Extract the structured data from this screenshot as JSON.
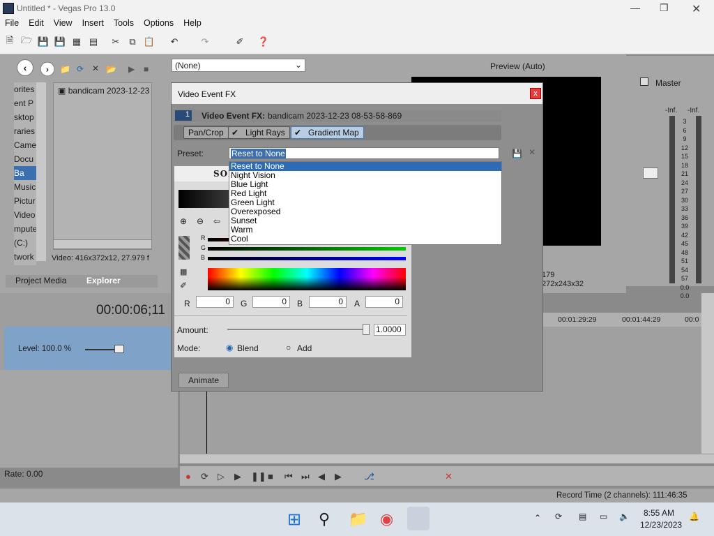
{
  "window": {
    "title": "Untitled * - Vegas Pro 13.0"
  },
  "menu": [
    "File",
    "Edit",
    "View",
    "Insert",
    "Tools",
    "Options",
    "Help"
  ],
  "explorer": {
    "tree": [
      "orites",
      "ent P",
      "sktop",
      "raries",
      "Came",
      "Docu",
      "Ba",
      "Music",
      "Pictur",
      "Video",
      "mpute",
      "(C:)",
      "twork"
    ],
    "file": "bandicam 2023-12-23",
    "info": "Video: 416x372x12, 27.979 f",
    "tabs": [
      "Project Media",
      "Explorer"
    ]
  },
  "preview": {
    "mode": "(None)",
    "quality": "Preview (Auto)",
    "info1": "179",
    "info2": "272x243x32"
  },
  "timeline": {
    "time": "00:00:06;11",
    "level": "Level: 100.0 %",
    "rate": "Rate: 0.00",
    "ruler": [
      "00:01:29:29",
      "00:01:44:29",
      "00:0"
    ]
  },
  "mixer": {
    "title": "Master",
    "inf_left": "-Inf.",
    "inf_right": "-Inf.",
    "scale": [
      "3",
      "6",
      "9",
      "12",
      "15",
      "18",
      "21",
      "24",
      "27",
      "30",
      "33",
      "36",
      "39",
      "42",
      "45",
      "48",
      "51",
      "54",
      "57",
      "0.0",
      "0.0"
    ]
  },
  "dialog": {
    "title": "Video Event FX",
    "close": "x",
    "track_num": "1",
    "fx_label": "Video Event FX:",
    "fx_event": "bandicam 2023-12-23 08-53-58-869",
    "chain": [
      "Pan/Crop",
      "Light Rays",
      "Gradient Map"
    ],
    "preset_label": "Preset:",
    "preset_value": "Reset to None",
    "preset_options": [
      "Reset to None",
      "Night Vision",
      "Blue Light",
      "Red  Light",
      "Green  Light",
      "Overexposed",
      "Sunset",
      "Warm",
      "Cool"
    ],
    "sony": "SON",
    "rgb_labels": [
      "R",
      "G",
      "B"
    ],
    "r_label": "R",
    "r_val": "0",
    "g_label": "G",
    "g_val": "0",
    "b_label": "B",
    "b_val": "0",
    "a_label": "A",
    "a_val": "0",
    "amount_label": "Amount:",
    "amount_val": "1.0000",
    "amount_level": 1.0,
    "mode_label": "Mode:",
    "mode_blend": "Blend",
    "mode_add": "Add",
    "animate": "Animate"
  },
  "status": {
    "record": "Record Time (2 channels): 111:46:35"
  },
  "taskbar": {
    "time": "8:55 AM",
    "date": "12/23/2023"
  }
}
